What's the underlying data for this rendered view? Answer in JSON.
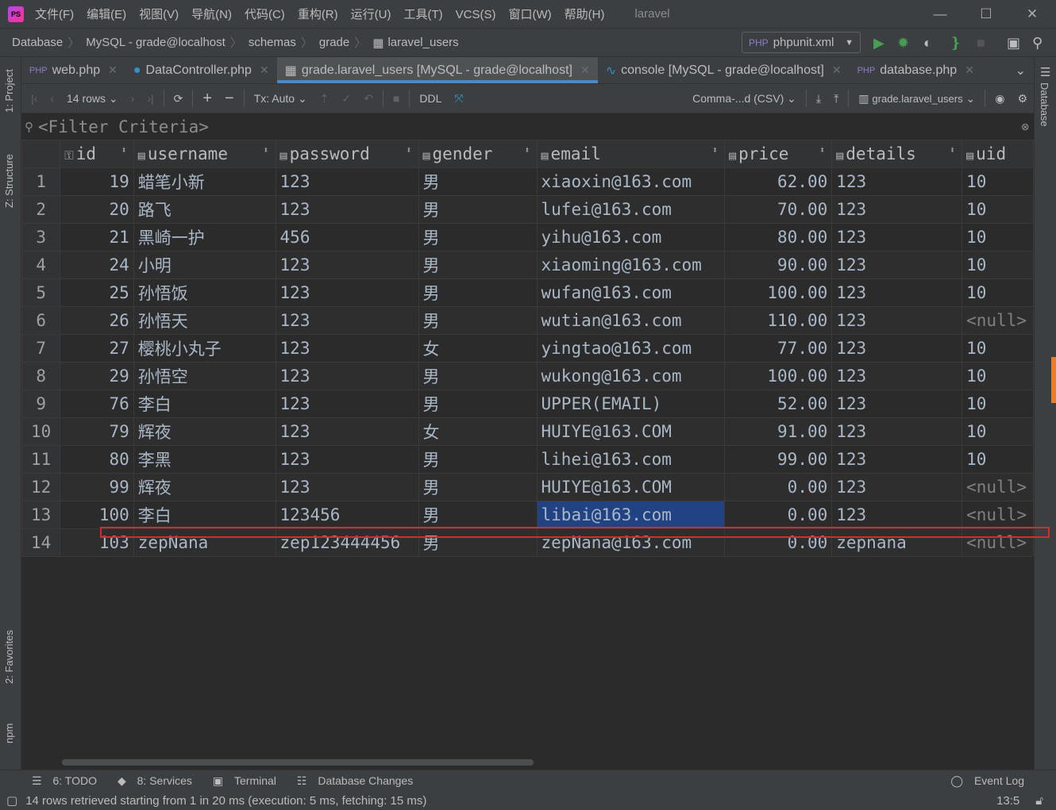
{
  "title_bar": {
    "logo": "PS",
    "menus": [
      "文件(F)",
      "编辑(E)",
      "视图(V)",
      "导航(N)",
      "代码(C)",
      "重构(R)",
      "运行(U)",
      "工具(T)",
      "VCS(S)",
      "窗口(W)",
      "帮助(H)"
    ],
    "project": "laravel"
  },
  "breadcrumb": [
    "Database",
    "MySQL - grade@localhost",
    "schemas",
    "grade",
    "laravel_users"
  ],
  "run_config": "phpunit.xml",
  "left_strip": [
    "1: Project",
    "Z: Structure",
    "2: Favorites",
    "npm"
  ],
  "right_strip": "Database",
  "tabs": [
    {
      "label": "web.php",
      "active": false
    },
    {
      "label": "DataController.php",
      "active": false
    },
    {
      "label": "grade.laravel_users [MySQL - grade@localhost]",
      "active": true
    },
    {
      "label": "console [MySQL - grade@localhost]",
      "active": false
    },
    {
      "label": "database.php",
      "active": false
    }
  ],
  "toolbar": {
    "rows": "14 rows",
    "tx": "Tx: Auto",
    "ddl": "DDL",
    "export_format": "Comma-...d (CSV)",
    "table": "grade.laravel_users"
  },
  "filter": {
    "placeholder": "<Filter Criteria>"
  },
  "table": {
    "columns": [
      "id",
      "username",
      "password",
      "gender",
      "email",
      "price",
      "details",
      "uid"
    ],
    "rows": [
      [
        "1",
        "19",
        "蜡笔小新",
        "123",
        "男",
        "xiaoxin@163.com",
        "62.00",
        "123",
        "10"
      ],
      [
        "2",
        "20",
        "路飞",
        "123",
        "男",
        "lufei@163.com",
        "70.00",
        "123",
        "10"
      ],
      [
        "3",
        "21",
        "黑崎一护",
        "456",
        "男",
        "yihu@163.com",
        "80.00",
        "123",
        "10"
      ],
      [
        "4",
        "24",
        "小明",
        "123",
        "男",
        "xiaoming@163.com",
        "90.00",
        "123",
        "10"
      ],
      [
        "5",
        "25",
        "孙悟饭",
        "123",
        "男",
        "wufan@163.com",
        "100.00",
        "123",
        "10"
      ],
      [
        "6",
        "26",
        "孙悟天",
        "123",
        "男",
        "wutian@163.com",
        "110.00",
        "123",
        "<null>"
      ],
      [
        "7",
        "27",
        "樱桃小丸子",
        "123",
        "女",
        "yingtao@163.com",
        "77.00",
        "123",
        "10"
      ],
      [
        "8",
        "29",
        "孙悟空",
        "123",
        "男",
        "wukong@163.com",
        "100.00",
        "123",
        "10"
      ],
      [
        "9",
        "76",
        "李白",
        "123",
        "男",
        "UPPER(EMAIL)",
        "52.00",
        "123",
        "10"
      ],
      [
        "10",
        "79",
        "辉夜",
        "123",
        "女",
        "HUIYE@163.COM",
        "91.00",
        "123",
        "10"
      ],
      [
        "11",
        "80",
        "李黑",
        "123",
        "男",
        "lihei@163.com",
        "99.00",
        "123",
        "10"
      ],
      [
        "12",
        "99",
        "辉夜",
        "123",
        "男",
        "HUIYE@163.COM",
        "0.00",
        "123",
        "<null>"
      ],
      [
        "13",
        "100",
        "李白",
        "123456",
        "男",
        "libai@163.com",
        "0.00",
        "123",
        "<null>"
      ],
      [
        "14",
        "103",
        "zepNana",
        "zep123444456",
        "男",
        "zepNana@163.com",
        "0.00",
        "zepnana",
        "<null>"
      ]
    ],
    "selected_cell": {
      "row": 13,
      "column": "email"
    }
  },
  "tool_windows": {
    "todo": "6: TODO",
    "services": "8: Services",
    "terminal": "Terminal",
    "db_changes": "Database Changes",
    "event_log": "Event Log"
  },
  "status": {
    "message": "14 rows retrieved starting from 1 in 20 ms (execution: 5 ms, fetching: 15 ms)",
    "position": "13:5"
  },
  "colors": {
    "selection": "#214283",
    "tab_accent": "#4a88c7",
    "highlight_box": "#d62b2b"
  }
}
